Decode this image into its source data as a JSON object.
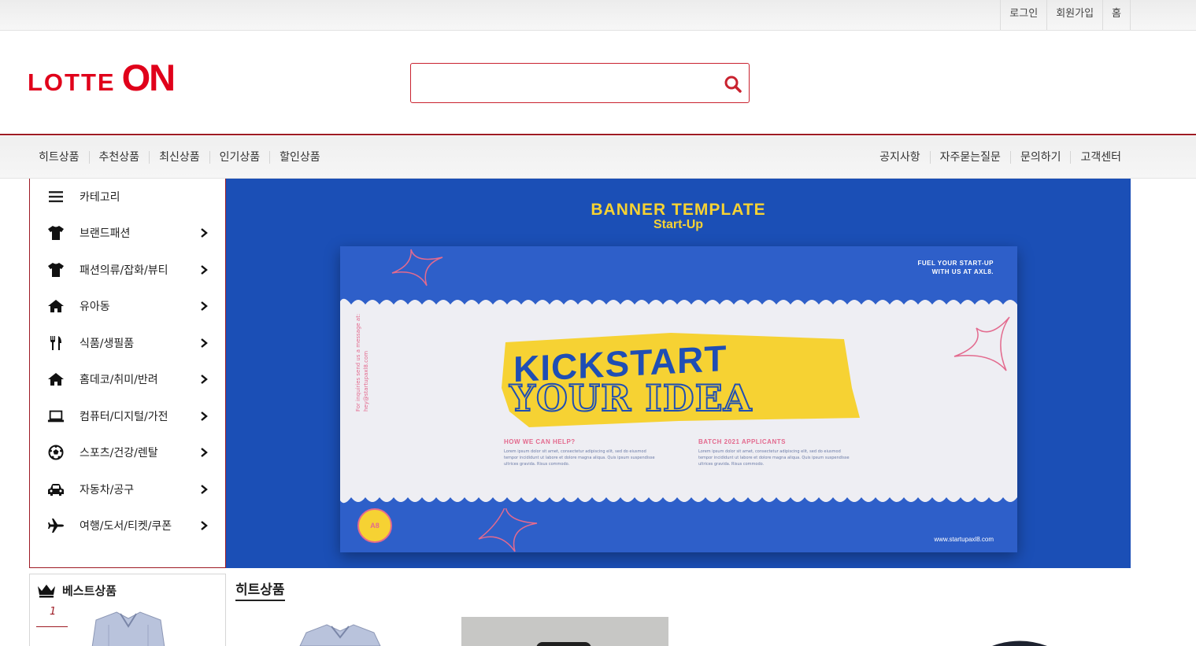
{
  "top_links": [
    "로그인",
    "회원가입",
    "홈"
  ],
  "logo": {
    "part1": "LOTTE",
    "part2": "ON"
  },
  "search": {
    "value": "",
    "placeholder": ""
  },
  "nav": {
    "left": [
      "히트상품",
      "추천상품",
      "최신상품",
      "인기상품",
      "할인상품"
    ],
    "right": [
      "공지사항",
      "자주묻는질문",
      "문의하기",
      "고객센터"
    ]
  },
  "categories": [
    {
      "label": "카테고리",
      "icon": "menu-icon",
      "arrow": false
    },
    {
      "label": "브랜드패션",
      "icon": "tshirt-icon",
      "arrow": true
    },
    {
      "label": "패션의류/잡화/뷰티",
      "icon": "tshirt-icon",
      "arrow": true
    },
    {
      "label": "유아동",
      "icon": "home-icon",
      "arrow": true
    },
    {
      "label": "식품/생필품",
      "icon": "utensils-icon",
      "arrow": true
    },
    {
      "label": "홈데코/취미/반려",
      "icon": "home-icon",
      "arrow": true
    },
    {
      "label": "컴퓨터/디지털/가전",
      "icon": "laptop-icon",
      "arrow": true
    },
    {
      "label": "스포츠/건강/렌탈",
      "icon": "soccer-ball-icon",
      "arrow": true
    },
    {
      "label": "자동차/공구",
      "icon": "car-icon",
      "arrow": true
    },
    {
      "label": "여행/도서/티켓/쿠폰",
      "icon": "plane-icon",
      "arrow": true
    }
  ],
  "banner": {
    "title": "BANNER TEMPLATE",
    "subtitle": "Start-Up",
    "fuel_line1": "FUEL YOUR START-UP",
    "fuel_line2": "WITH US AT AXL8.",
    "headline1": "KICKSTART",
    "headline2": "YOUR IDEA",
    "col1_head": "HOW WE CAN HELP?",
    "col2_head": "BATCH 2021 APPLICANTS",
    "col_text": "Lorem ipsum dolor sit amet, consectetur adipiscing elit, sed do eiusmod tempor incididunt ut labore et dolore magna aliqua. Quis ipsum suspendisse ultrices gravida. Risus commodo.",
    "side_text": "For inquiries send us a message at: hey@startupaxl8.com",
    "badge": "A8",
    "url": "www.startupaxl8.com"
  },
  "best": {
    "title": "베스트상품",
    "rank": "1"
  },
  "hit": {
    "title": "히트상품"
  },
  "colors": {
    "brand_red": "#e0001a",
    "border_red": "#9e1b24",
    "banner_blue": "#1b4fb6",
    "banner_yellow": "#f6d233",
    "banner_pink": "#e36a8e"
  }
}
